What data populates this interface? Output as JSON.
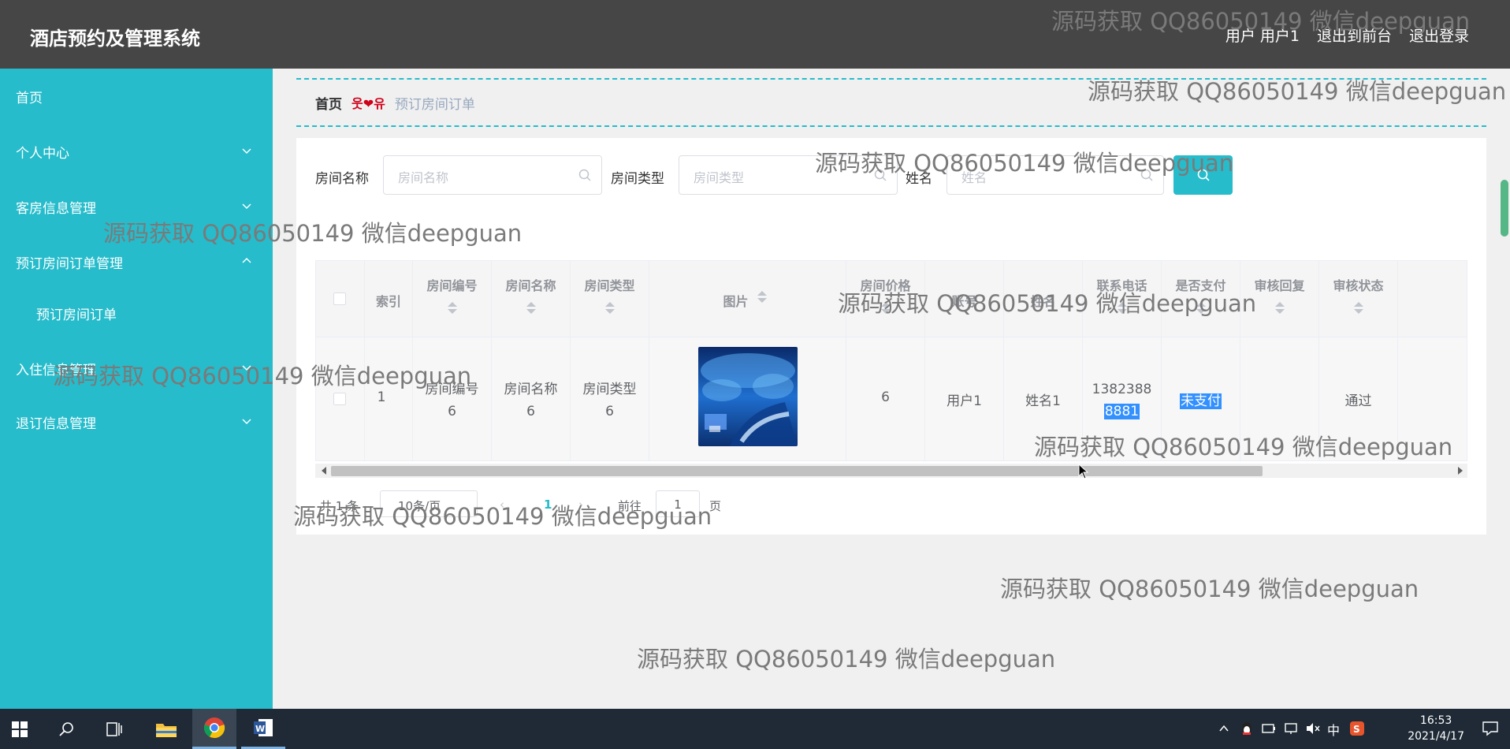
{
  "header": {
    "title": "酒店预约及管理系统",
    "user": "用户 用户1",
    "back_front": "退出到前台",
    "logout": "退出登录"
  },
  "sidebar": {
    "items": [
      {
        "label": "首页"
      },
      {
        "label": "个人中心"
      },
      {
        "label": "客房信息管理"
      },
      {
        "label": "预订房间订单管理"
      },
      {
        "label": "预订房间订单"
      },
      {
        "label": "入住信息管理"
      },
      {
        "label": "退订信息管理"
      }
    ]
  },
  "breadcrumb": {
    "home": "首页",
    "separator": "웃❤유",
    "current": "预订房间订单"
  },
  "search": {
    "room_name_label": "房间名称",
    "room_name_placeholder": "房间名称",
    "room_type_label": "房间类型",
    "room_type_placeholder": "房间类型",
    "name_label": "姓名",
    "name_placeholder": "姓名"
  },
  "table": {
    "headers": {
      "index": "索引",
      "room_no": "房间编号",
      "room_name": "房间名称",
      "room_type": "房间类型",
      "image": "图片",
      "price": "房间价格",
      "account": "账号",
      "name": "姓名",
      "phone": "联系电话",
      "paid": "是否支付",
      "reply": "审核回复",
      "status": "审核状态"
    },
    "rows": [
      {
        "index": "1",
        "room_no_1": "房间编号",
        "room_no_2": "6",
        "room_name_1": "房间名称",
        "room_name_2": "6",
        "room_type_1": "房间类型",
        "room_type_2": "6",
        "price": "6",
        "account": "用户1",
        "name": "姓名1",
        "phone_1": "1382388",
        "phone_2": "8881",
        "paid": "未支付",
        "reply": "",
        "status": "通过"
      }
    ]
  },
  "pagination": {
    "total": "共 1 条",
    "page_size": "10条/页",
    "prev": "‹",
    "current_page": "1",
    "next": "›",
    "goto": "前往",
    "jump_value": "1",
    "page_suffix": "页"
  },
  "watermark": "源码获取 QQ86050149 微信deepguan",
  "taskbar": {
    "time": "16:53",
    "date": "2021/4/17",
    "ime": "中"
  }
}
